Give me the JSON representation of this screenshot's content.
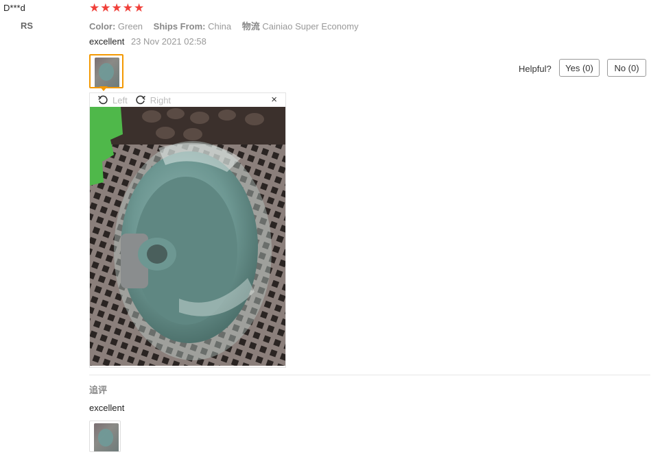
{
  "reviewer": {
    "name": "D***d",
    "country": "RS"
  },
  "rating": {
    "stars": 5,
    "max": 5
  },
  "props": [
    {
      "label": "Color:",
      "value": "Green"
    },
    {
      "label": "Ships From:",
      "value": "China"
    },
    {
      "label": "物流",
      "value": "Cainiao Super Economy"
    }
  ],
  "review": {
    "text": "excellent",
    "date": "23 Nov 2021 02:58"
  },
  "helpful": {
    "label": "Helpful?",
    "yes": "Yes (0)",
    "no": "No (0)"
  },
  "viewer": {
    "rotate_left": "Left",
    "rotate_right": "Right",
    "close": "×"
  },
  "followup": {
    "title": "追评",
    "text": "excellent"
  },
  "colors": {
    "star": "#f0403a",
    "active_border": "#f39800"
  }
}
